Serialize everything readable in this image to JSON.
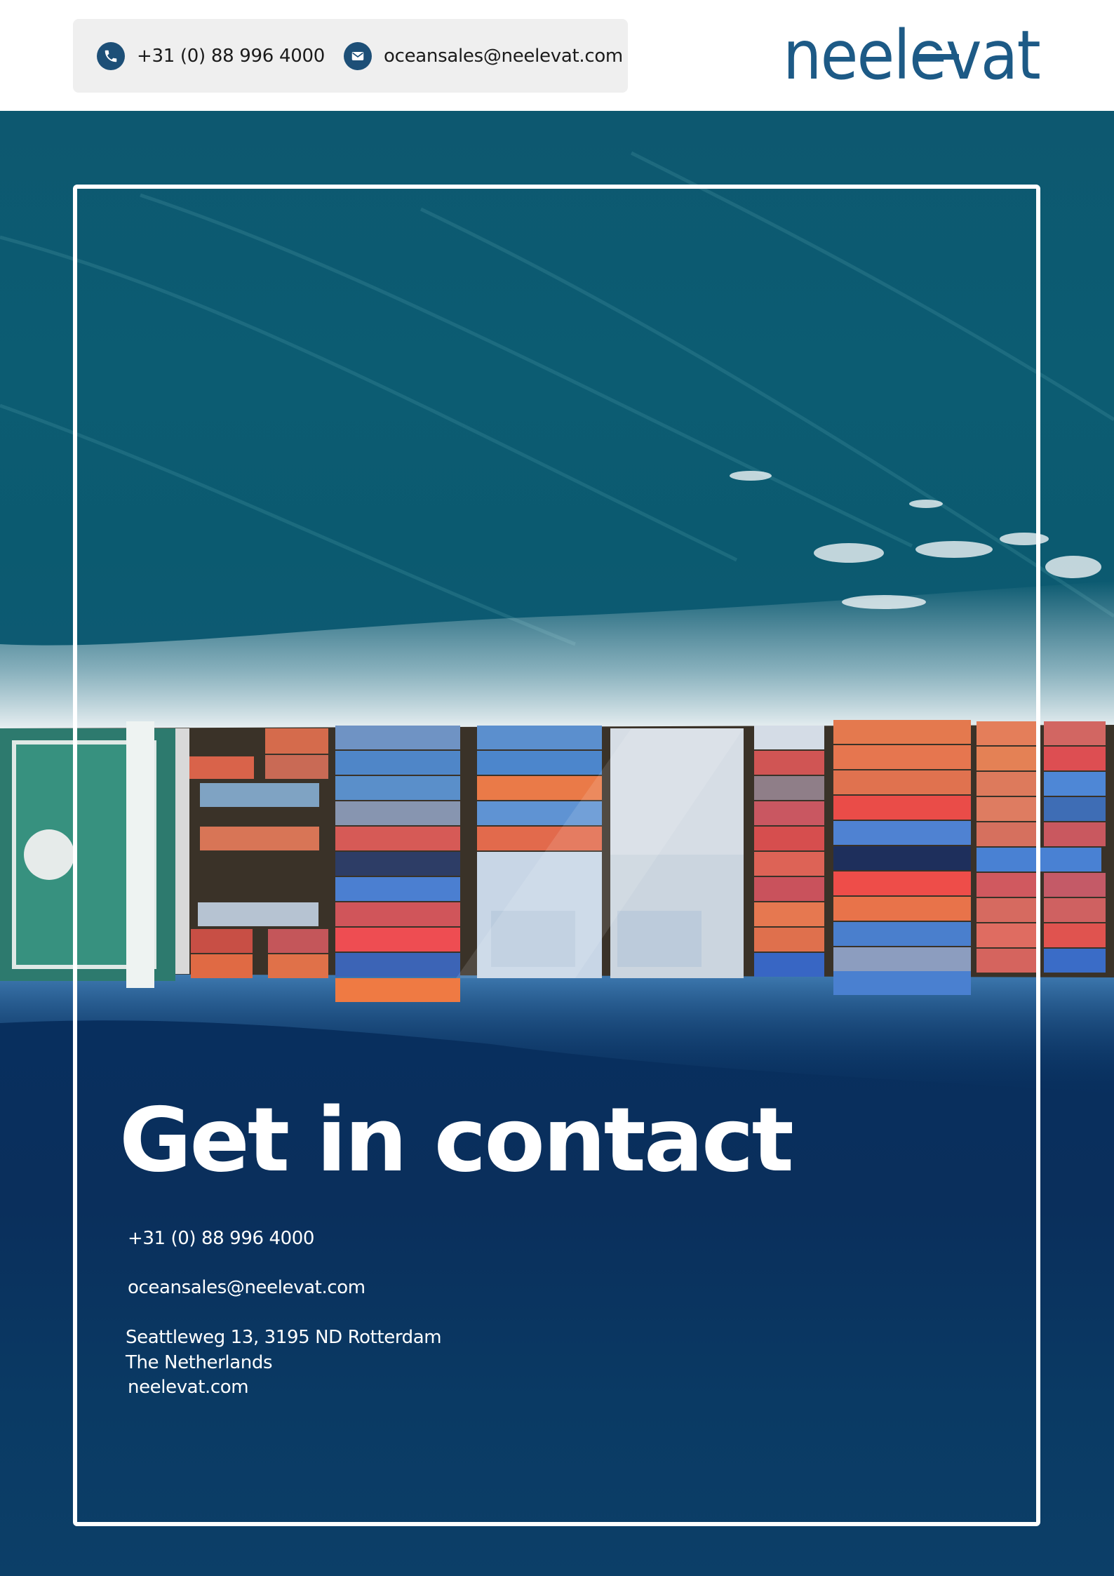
{
  "header": {
    "phone": "+31 (0) 88 996 4000",
    "email": "oceansales@neelevat.com",
    "phone_icon": "phone-icon",
    "email_icon": "mail-icon",
    "logo_text": "neelevat"
  },
  "hero": {
    "headline": "Get in contact",
    "phone": "+31 (0) 88 996 4000",
    "email": "oceansales@neelevat.com",
    "address_line1": "Seattleweg 13, 3195 ND Rotterdam",
    "address_line2": "The Netherlands",
    "website": "neelevat.com"
  },
  "colors": {
    "brand_blue": "#1d4f77",
    "ocean_teal": "#0c5c72",
    "ocean_deep": "#082f5e",
    "frame": "#ffffff"
  }
}
